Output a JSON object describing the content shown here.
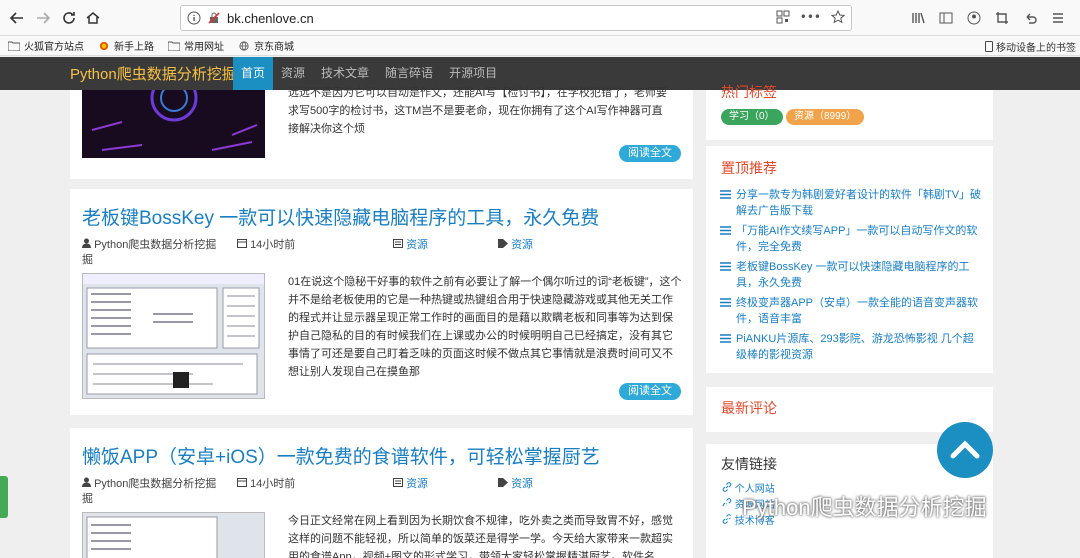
{
  "browser": {
    "url": "bk.chenlove.cn",
    "bookmarks": [
      "火狐官方站点",
      "新手上路",
      "常用网址",
      "京东商城"
    ],
    "mobile_bookmarks": "移动设备上的书签"
  },
  "site": {
    "brand": "Python爬虫数据分析挖掘",
    "menu": [
      "首页",
      "资源",
      "技术文章",
      "随言碎语",
      "开源项目"
    ],
    "active_menu": "首页"
  },
  "posts": [
    {
      "excerpt_partial_line1": "远远不是因为它可以自动是作文，还能AI写【检讨书】，在学校犯错了，老师要",
      "excerpt_line2": "求写500字的检讨书，这TM岂不是要老命，现在你拥有了这个AI写作神器可直",
      "excerpt_line3": "接解决你这个烦",
      "read_more": "阅读全文"
    },
    {
      "title": "老板键BossKey 一款可以快速隐藏电脑程序的工具，永久免费",
      "author": "Python爬虫数据分析挖掘",
      "time": "14小时前",
      "category": "资源",
      "tag": "资源",
      "excerpt": "01在说这个隐秘干好事的软件之前有必要让了解一个偶尔听过的词“老板键”，这个并不是给老板使用的它是一种热键或热键组合用于快速隐藏游戏或其他无关工作的程式并让显示器呈现正常工作时的画面目的是藉以欺瞒老板和同事等为达到保护自己隐私的目的有时候我们在上课或办公的时候明明自己已经搞定，没有其它事情了可还是要自己盯着乏味的页面这时候不做点其它事情就是浪费时间可又不想让别人发现自己在摸鱼那",
      "read_more": "阅读全文"
    },
    {
      "title": "懒饭APP（安卓+iOS）一款免费的食谱软件，可轻松掌握厨艺",
      "author": "Python爬虫数据分析挖掘",
      "time": "14小时前",
      "category": "资源",
      "tag": "资源",
      "excerpt": "今日正文经常在网上看到因为长期饮食不规律，吃外卖之类而导致胃不好，感觉这样的问题不能轻视，所以简单的饭菜还是得学一学。今天给大家带来一款超实用的食谱App，视频+图文的形式学习，带领大家轻松掌握精湛厨艺。软件名"
    }
  ],
  "sidebar": {
    "hot_tags_title": "热门标签",
    "tags": [
      {
        "label": "学习（0）",
        "color": "#3ba55d"
      },
      {
        "label": "资源（8999）",
        "color": "#f0a34a"
      }
    ],
    "pinned_title": "置顶推荐",
    "pinned": [
      "分享一款专为韩剧爱好者设计的软件「韩剧TV」破解去广告版下载",
      "「万能AI作文续写APP」一款可以自动写作文的软件，完全免费",
      "老板键BossKey 一款可以快速隐藏电脑程序的工具，永久免费",
      "终极变声器APP（安卓）一款全能的语音变声器软件，语音丰富",
      "PiANKU片源库、293影院、游龙恐怖影视 几个超级棒的影视资源"
    ],
    "comments_title": "最新评论",
    "friends_title": "友情链接",
    "friends": [
      "个人网站",
      "资源网站",
      "技术博客"
    ]
  },
  "watermark": "Python爬虫数据分析挖掘",
  "colors": {
    "link": "#1a7ec0",
    "accent": "#1b8ec2",
    "sidebar_title": "#e04a2b",
    "nav_bg": "#3a3a3a",
    "brand": "#f5c045"
  }
}
